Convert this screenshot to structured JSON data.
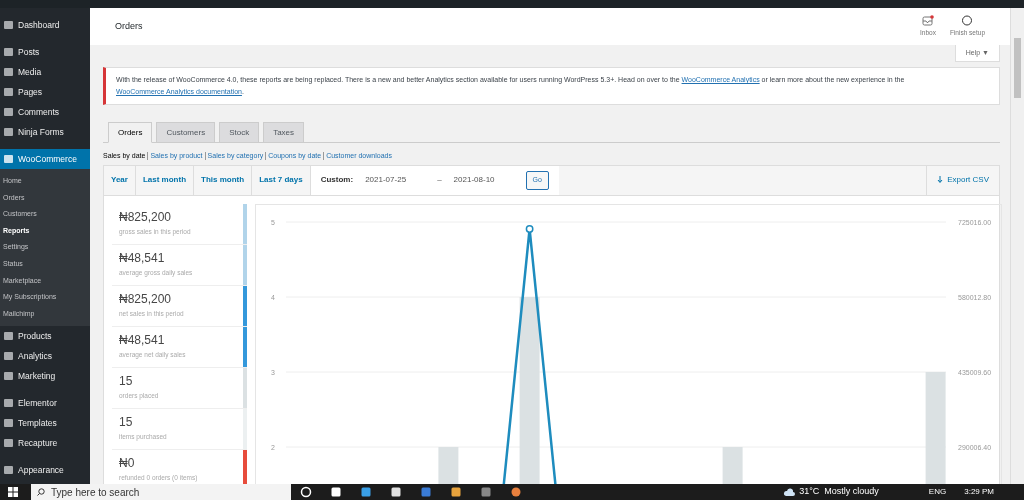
{
  "sidebar": {
    "sections": [
      {
        "items": [
          {
            "label": "Dashboard",
            "selected": false
          }
        ]
      },
      {
        "items": [
          {
            "label": "Posts",
            "selected": false
          },
          {
            "label": "Media",
            "selected": false
          },
          {
            "label": "Pages",
            "selected": false
          },
          {
            "label": "Comments",
            "selected": false
          },
          {
            "label": "Ninja Forms",
            "selected": false
          }
        ]
      },
      {
        "items": [
          {
            "label": "WooCommerce",
            "selected": true,
            "children": [
              {
                "label": "Home",
                "selected": false
              },
              {
                "label": "Orders",
                "selected": false
              },
              {
                "label": "Customers",
                "selected": false
              },
              {
                "label": "Reports",
                "selected": true
              },
              {
                "label": "Settings",
                "selected": false
              },
              {
                "label": "Status",
                "selected": false
              },
              {
                "label": "Marketplace",
                "selected": false
              },
              {
                "label": "My Subscriptions",
                "selected": false
              },
              {
                "label": "Mailchimp",
                "selected": false
              }
            ]
          },
          {
            "label": "Products",
            "selected": false
          },
          {
            "label": "Analytics",
            "selected": false
          },
          {
            "label": "Marketing",
            "selected": false
          }
        ]
      },
      {
        "items": [
          {
            "label": "Elementor",
            "selected": false
          },
          {
            "label": "Templates",
            "selected": false
          },
          {
            "label": "Recapture",
            "selected": false
          }
        ]
      },
      {
        "items": [
          {
            "label": "Appearance",
            "selected": false
          }
        ]
      }
    ]
  },
  "header": {
    "title": "Orders",
    "actions": [
      {
        "kind": "inbox",
        "label": "Inbox",
        "unread": true
      },
      {
        "kind": "setup",
        "label": "Finish setup"
      }
    ]
  },
  "help": {
    "label": "Help ▼"
  },
  "notice": {
    "parts": [
      {
        "kind": "text",
        "text": "With the release of WooCommerce 4.0, these reports are being replaced. There is a new and better Analytics section available for users running WordPress 5.3+. Head on over to the "
      },
      {
        "kind": "link",
        "text": "WooCommerce Analytics"
      },
      {
        "kind": "text",
        "text": " or learn more about the new experience in the "
      },
      {
        "kind": "link",
        "text": "WooCommerce Analytics documentation"
      },
      {
        "kind": "text",
        "text": "."
      }
    ]
  },
  "tabs": [
    {
      "label": "Orders",
      "selected": true
    },
    {
      "label": "Customers",
      "selected": false
    },
    {
      "label": "Stock",
      "selected": false
    },
    {
      "label": "Taxes",
      "selected": false
    }
  ],
  "report_links": [
    {
      "label": "Sales by date",
      "selected": true
    },
    {
      "label": "Sales by product",
      "selected": false
    },
    {
      "label": "Sales by category",
      "selected": false
    },
    {
      "label": "Coupons by date",
      "selected": false
    },
    {
      "label": "Customer downloads",
      "selected": false
    }
  ],
  "ranges": [
    {
      "label": "Year",
      "selected": false
    },
    {
      "label": "Last month",
      "selected": false
    },
    {
      "label": "This month",
      "selected": false
    },
    {
      "label": "Last 7 days",
      "selected": false
    }
  ],
  "custom": {
    "label": "Custom:",
    "selected": true,
    "from": "2021-07-25",
    "separator": "–",
    "to": "2021-08-10",
    "button": "Go"
  },
  "export": {
    "label": "Export CSV"
  },
  "legend": [
    {
      "value": "₦825,200",
      "label": "gross sales in this period",
      "color": "#b1d4ea"
    },
    {
      "value": "₦48,541",
      "label": "average gross daily sales",
      "color": "#b1d4ea"
    },
    {
      "value": "₦825,200",
      "label": "net sales in this period",
      "color": "#3498db"
    },
    {
      "value": "₦48,541",
      "label": "average net daily sales",
      "color": "#3498db"
    },
    {
      "value": "15",
      "label": "orders placed",
      "color": "#dbe1e3"
    },
    {
      "value": "15",
      "label": "items purchased",
      "color": "#ecf0f1"
    },
    {
      "value": "₦0",
      "label": "refunded 0 orders (0 items)",
      "color": "#e74c3c"
    }
  ],
  "chart": {
    "left_ticks": [
      "5",
      "4",
      "3",
      "2"
    ],
    "right_ticks": [
      "725016.00",
      "580012.80",
      "435009.60",
      "290006.40"
    ]
  },
  "taskbar": {
    "search_placeholder": "Type here to search",
    "weather": "31°C  Mostly cloudy",
    "language": "ENG",
    "time": "3:29 PM"
  }
}
